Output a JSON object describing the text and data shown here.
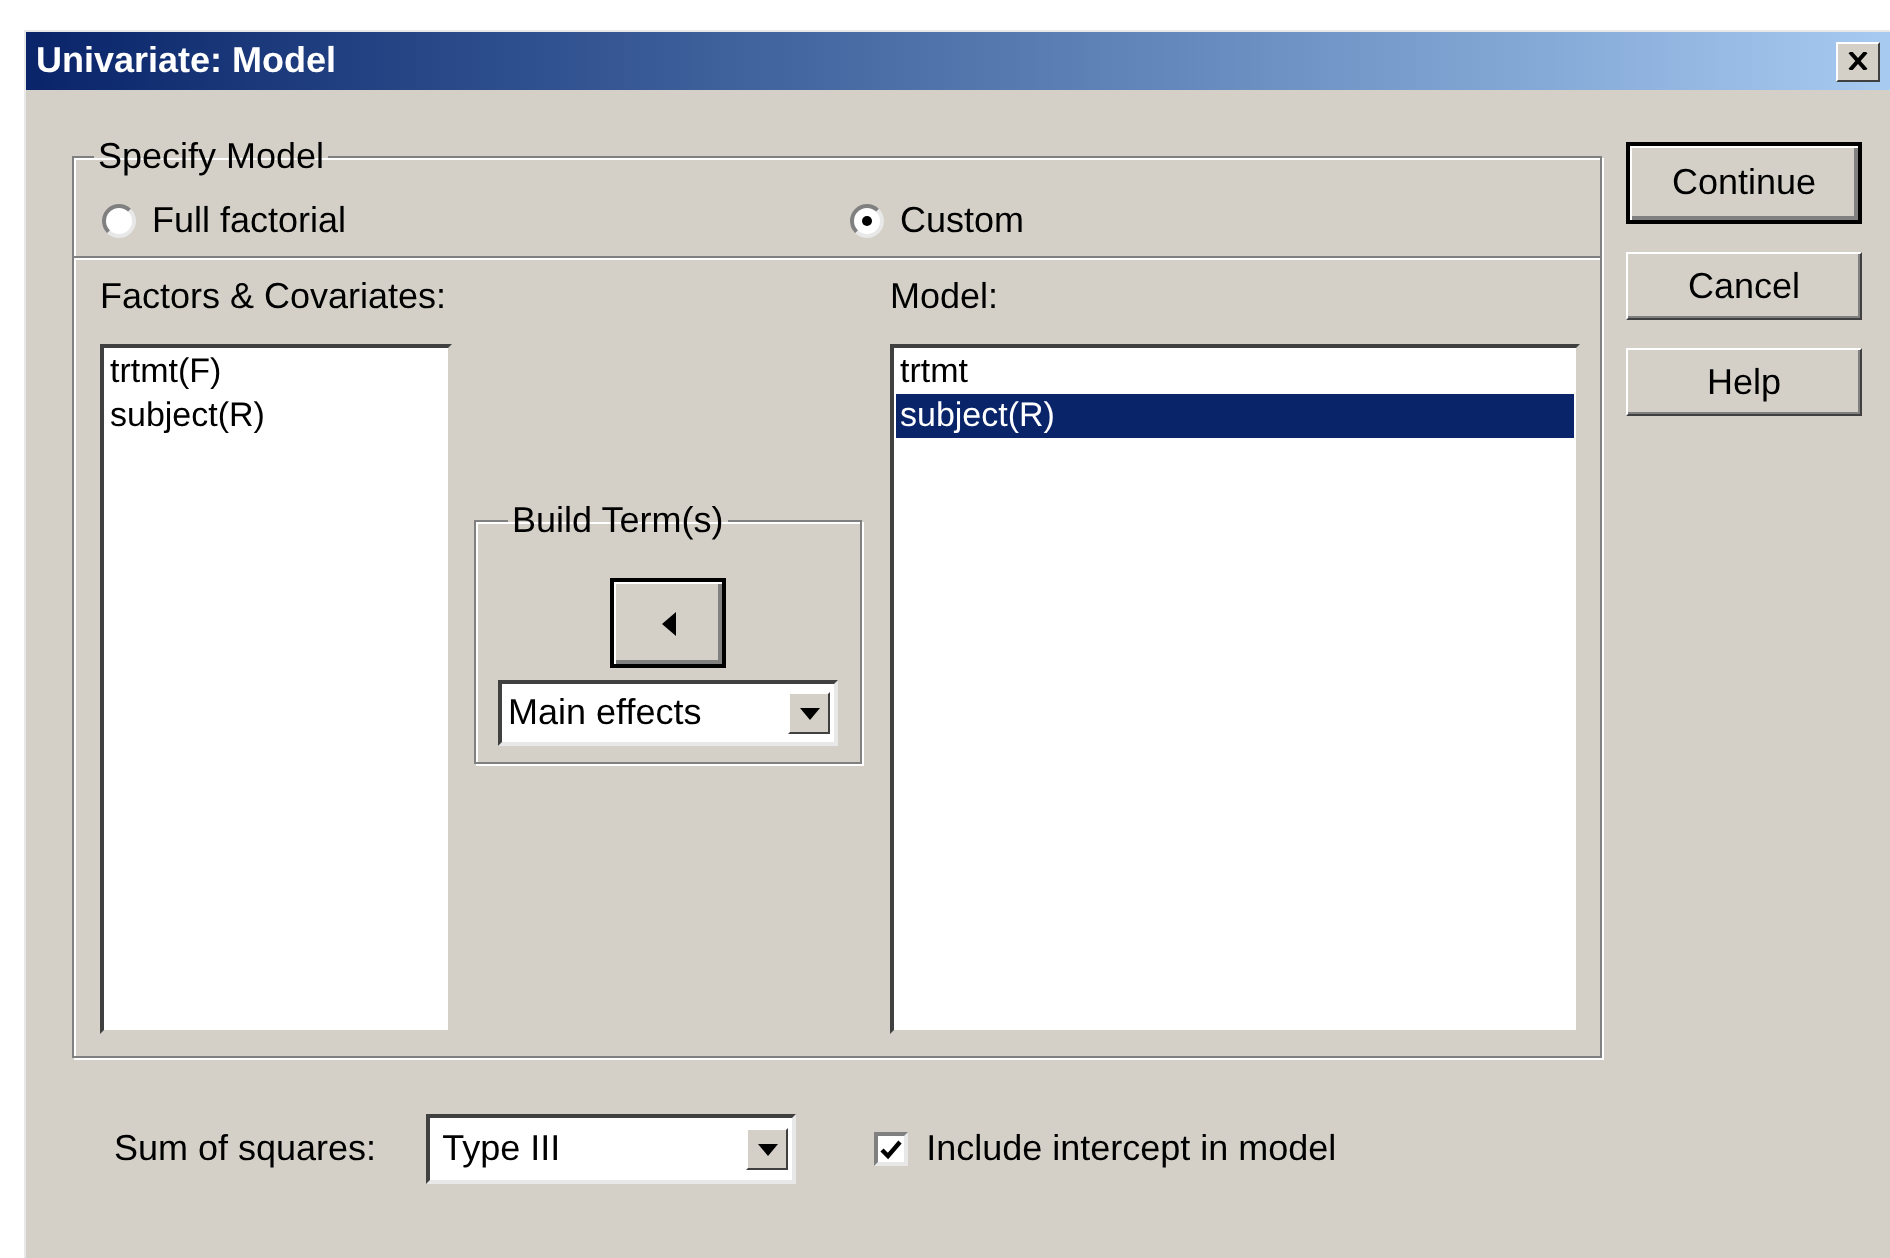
{
  "window": {
    "title": "Univariate: Model"
  },
  "specify_model": {
    "legend": "Specify Model",
    "options": [
      {
        "label": "Full factorial",
        "selected": false
      },
      {
        "label": "Custom",
        "selected": true
      }
    ]
  },
  "factors_list": {
    "label": "Factors & Covariates:",
    "items": [
      {
        "label": "trtmt(F)",
        "selected": false
      },
      {
        "label": "subject(R)",
        "selected": false
      }
    ]
  },
  "build_terms": {
    "legend": "Build Term(s)",
    "dropdown": {
      "value": "Main effects"
    }
  },
  "model_list": {
    "label": "Model:",
    "items": [
      {
        "label": "trtmt",
        "selected": false
      },
      {
        "label": "subject(R)",
        "selected": true
      }
    ]
  },
  "buttons": [
    {
      "label": "Continue",
      "default": true
    },
    {
      "label": "Cancel",
      "default": false
    },
    {
      "label": "Help",
      "default": false
    }
  ],
  "sum_of_squares": {
    "label": "Sum of squares:",
    "value": "Type III"
  },
  "include_intercept": {
    "label": "Include intercept in model",
    "checked": true
  }
}
